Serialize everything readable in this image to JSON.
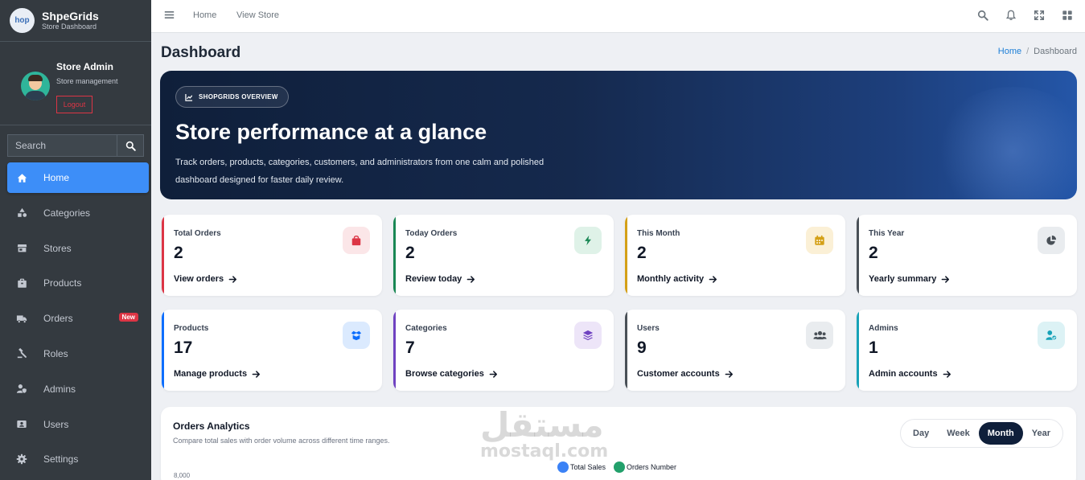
{
  "brand": {
    "logo_text": "hop",
    "name": "ShpeGrids",
    "subtitle": "Store Dashboard"
  },
  "user": {
    "name": "Store Admin",
    "role": "Store management",
    "logout_label": "Logout"
  },
  "search": {
    "placeholder": "Search"
  },
  "nav": [
    {
      "label": "Home",
      "icon": "home-icon",
      "active": true
    },
    {
      "label": "Categories",
      "icon": "shapes-icon"
    },
    {
      "label": "Stores",
      "icon": "store-icon"
    },
    {
      "label": "Products",
      "icon": "box-icon"
    },
    {
      "label": "Orders",
      "icon": "truck-icon",
      "badge": "New"
    },
    {
      "label": "Roles",
      "icon": "gavel-icon"
    },
    {
      "label": "Admins",
      "icon": "user-shield-icon"
    },
    {
      "label": "Users",
      "icon": "id-card-icon"
    },
    {
      "label": "Settings",
      "icon": "gear-icon"
    }
  ],
  "topbar": {
    "home_link": "Home",
    "view_store_link": "View Store"
  },
  "page": {
    "title": "Dashboard",
    "breadcrumb_home": "Home",
    "breadcrumb_current": "Dashboard"
  },
  "hero": {
    "pill": "SHOPGRIDS OVERVIEW",
    "title": "Store performance at a glance",
    "description": "Track orders, products, categories, customers, and administrators from one calm and polished dashboard designed for faster daily review."
  },
  "stats": [
    {
      "label": "Total Orders",
      "value": "2",
      "link": "View orders",
      "icon": "shopping-bag-icon",
      "accent": "#dc3545"
    },
    {
      "label": "Today Orders",
      "value": "2",
      "link": "Review today",
      "icon": "bolt-icon",
      "accent": "#198754"
    },
    {
      "label": "This Month",
      "value": "2",
      "link": "Monthly activity",
      "icon": "calendar-icon",
      "accent": "#d4a017"
    },
    {
      "label": "This Year",
      "value": "2",
      "link": "Yearly summary",
      "icon": "pie-chart-icon",
      "accent": "#495057"
    },
    {
      "label": "Products",
      "value": "17",
      "link": "Manage products",
      "icon": "box-open-icon",
      "accent": "#0d6efd"
    },
    {
      "label": "Categories",
      "value": "7",
      "link": "Browse categories",
      "icon": "layers-icon",
      "accent": "#6f42c1"
    },
    {
      "label": "Users",
      "value": "9",
      "link": "Customer accounts",
      "icon": "users-icon",
      "accent": "#495057"
    },
    {
      "label": "Admins",
      "value": "1",
      "link": "Admin accounts",
      "icon": "user-check-icon",
      "accent": "#17a2b8"
    }
  ],
  "analytics": {
    "title": "Orders Analytics",
    "subtitle": "Compare total sales with order volume across different time ranges.",
    "ranges": [
      "Day",
      "Week",
      "Month",
      "Year"
    ],
    "active_range": "Month",
    "legend": [
      {
        "name": "Total Sales",
        "color": "#3b82f6"
      },
      {
        "name": "Orders Number",
        "color": "#22a06b"
      }
    ],
    "y_top_tick": "8,000"
  },
  "watermark": {
    "arabic": "مستقل",
    "latin": "mostaql.com"
  }
}
